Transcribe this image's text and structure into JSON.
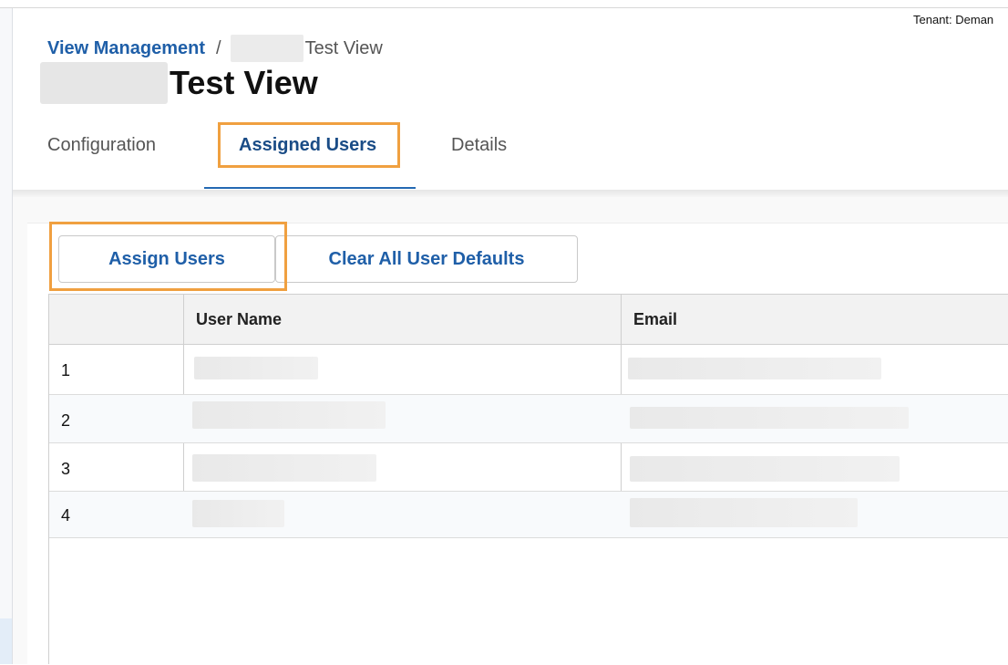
{
  "header": {
    "tenant_label": "Tenant: Deman"
  },
  "breadcrumb": {
    "root_label": "View Management",
    "separator": "/",
    "current_label": "Test View"
  },
  "page": {
    "title": "Test View"
  },
  "tabs": [
    {
      "label": "Configuration",
      "active": false
    },
    {
      "label": "Assigned Users",
      "active": true
    },
    {
      "label": "Details",
      "active": false
    }
  ],
  "toolbar": {
    "assign_users_label": "Assign Users",
    "clear_defaults_label": "Clear All User Defaults"
  },
  "table": {
    "columns": [
      "",
      "User Name",
      "Email"
    ],
    "rows": [
      {
        "index": "1"
      },
      {
        "index": "2"
      },
      {
        "index": "3"
      },
      {
        "index": "4"
      }
    ]
  },
  "colors": {
    "accent": "#1f5fa8",
    "active_tab": "#1a4c86",
    "highlight": "#f0a040"
  }
}
